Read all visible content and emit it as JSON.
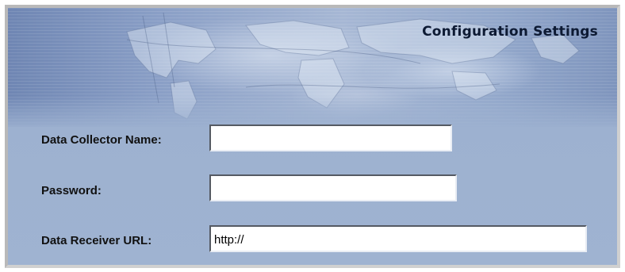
{
  "header": {
    "title": "Configuration Settings"
  },
  "form": {
    "collector_name": {
      "label": "Data Collector Name:",
      "value": ""
    },
    "password": {
      "label": "Password:",
      "value": ""
    },
    "receiver_url": {
      "label": "Data Receiver URL:",
      "value": "http://"
    }
  },
  "colors": {
    "panel_background": "#9db1d0",
    "banner_blue": "#8a9fc6",
    "title_text": "#0d1a33",
    "label_text": "#111111"
  }
}
